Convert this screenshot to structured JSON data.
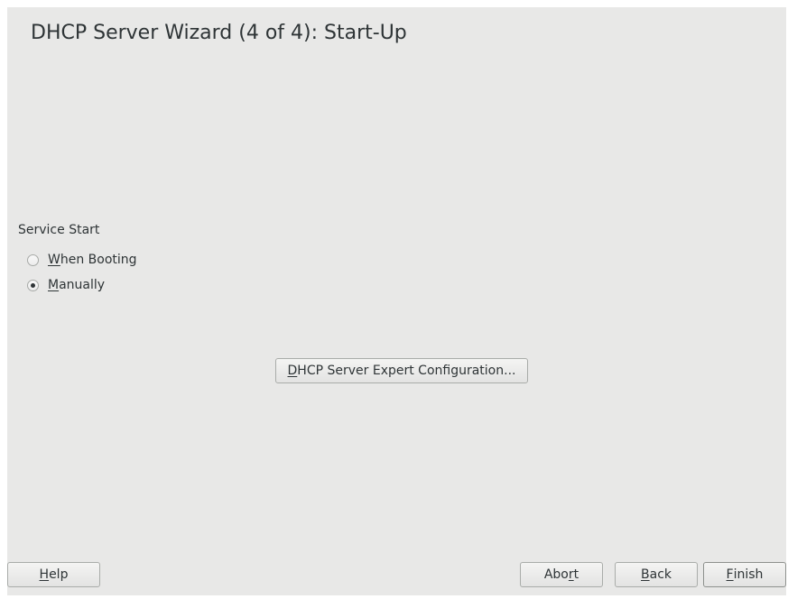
{
  "wizard": {
    "title": "DHCP Server Wizard (4 of 4): Start-Up"
  },
  "service_start": {
    "label": "Service Start",
    "options": [
      {
        "mnemonic": "W",
        "rest": "hen Booting",
        "selected": false
      },
      {
        "mnemonic": "M",
        "rest": "anually",
        "selected": true
      }
    ]
  },
  "expert_button": {
    "mnemonic": "D",
    "rest": "HCP Server Expert Configuration..."
  },
  "footer": {
    "help": {
      "mnemonic": "H",
      "rest": "elp"
    },
    "abort": {
      "before": "Abo",
      "mnemonic": "r",
      "rest": "t"
    },
    "back": {
      "mnemonic": "B",
      "rest": "ack"
    },
    "finish": {
      "mnemonic": "F",
      "rest": "inish"
    }
  },
  "colors": {
    "background": "#e8e8e7",
    "text": "#2e3436",
    "button_border": "#a9aca9"
  }
}
